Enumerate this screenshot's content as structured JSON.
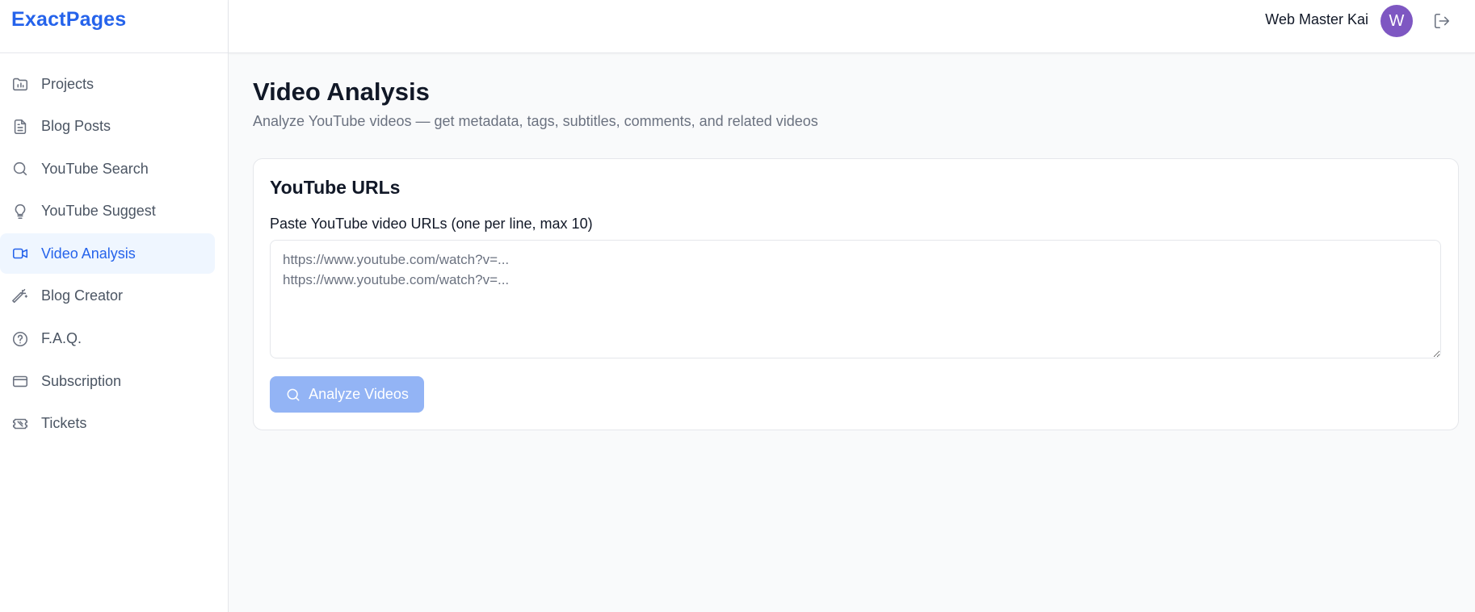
{
  "brand": {
    "name": "ExactPages",
    "color": "#2563eb"
  },
  "sidebar": {
    "items": [
      {
        "label": "Projects",
        "icon": "folder-chart-icon",
        "active": false
      },
      {
        "label": "Blog Posts",
        "icon": "document-icon",
        "active": false
      },
      {
        "label": "YouTube Search",
        "icon": "search-icon",
        "active": false
      },
      {
        "label": "YouTube Suggest",
        "icon": "lightbulb-icon",
        "active": false
      },
      {
        "label": "Video Analysis",
        "icon": "video-camera-icon",
        "active": true
      },
      {
        "label": "Blog Creator",
        "icon": "magic-wand-icon",
        "active": false
      },
      {
        "label": "F.A.Q.",
        "icon": "help-circle-icon",
        "active": false
      },
      {
        "label": "Subscription",
        "icon": "credit-card-icon",
        "active": false
      },
      {
        "label": "Tickets",
        "icon": "ticket-icon",
        "active": false
      }
    ]
  },
  "header": {
    "user_name": "Web Master Kai",
    "avatar_initial": "W",
    "avatar_color": "#7e57c2",
    "logout_icon": "logout-icon"
  },
  "main": {
    "title": "Video Analysis",
    "subtitle": "Analyze YouTube videos — get metadata, tags, subtitles, comments, and related videos",
    "card": {
      "title": "YouTube URLs",
      "field_label": "Paste YouTube video URLs (one per line, max 10)",
      "textarea_value": "",
      "textarea_placeholder": "https://www.youtube.com/watch?v=...\nhttps://www.youtube.com/watch?v=...",
      "button_label": "Analyze Videos",
      "button_icon": "search-icon",
      "button_color": "#93b4f5"
    }
  }
}
